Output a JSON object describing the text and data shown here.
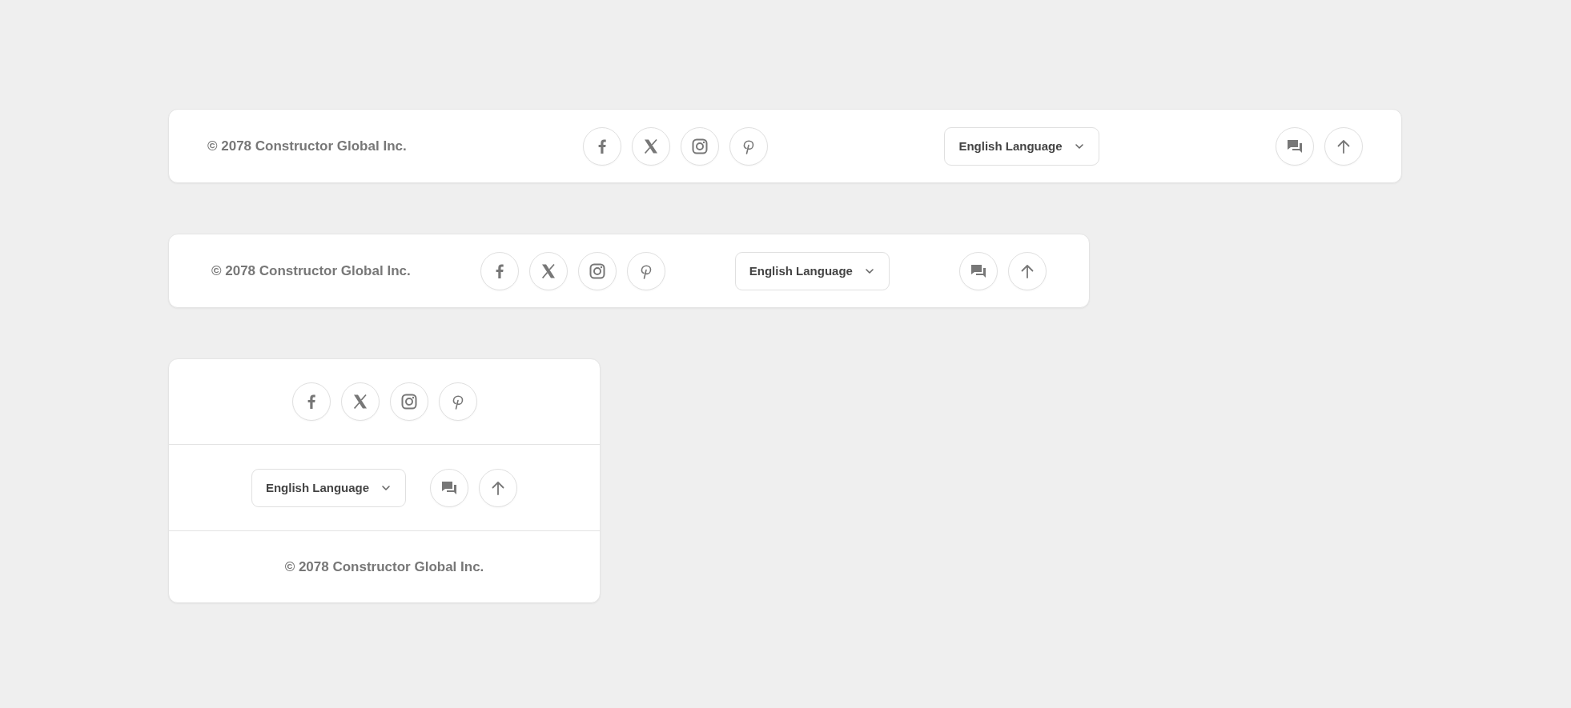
{
  "footers": [
    {
      "kind": "row",
      "copyright": "© 2078 Constructor Global Inc.",
      "language": "English Language"
    },
    {
      "kind": "compact",
      "copyright": "© 2078 Constructor Global Inc.",
      "language": "English Language"
    },
    {
      "kind": "stacked",
      "copyright": "© 2078 Constructor Global Inc.",
      "language": "English Language"
    }
  ]
}
